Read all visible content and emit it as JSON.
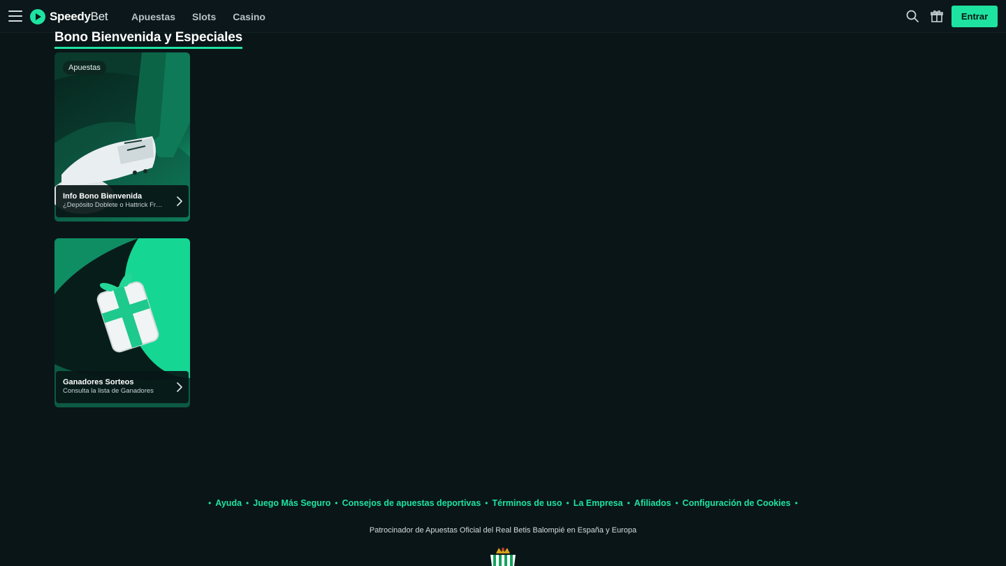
{
  "header": {
    "menu_icon": "hamburger-icon",
    "logo": {
      "bold": "Speedy",
      "thin": "Bet"
    },
    "nav": [
      {
        "label": "Apuestas"
      },
      {
        "label": "Slots"
      },
      {
        "label": "Casino"
      }
    ],
    "search_icon": "search-icon",
    "gift_icon": "gift-icon",
    "enter_label": "Entrar"
  },
  "main": {
    "section_title": "Bono Bienvenida y Especiales",
    "cards": [
      {
        "tag": "Apuestas",
        "title": "Info Bono Bienvenida",
        "subtitle": "¿Depósito Doblete o Hattrick Fr…",
        "art": "football-boot-image"
      },
      {
        "title": "Ganadores Sorteos",
        "subtitle": "Consulta la lista de Ganadores",
        "art": "gift-box-image"
      }
    ]
  },
  "footer": {
    "links": [
      "Ayuda",
      "Juego Más Seguro",
      "Consejos de apuestas deportivas",
      "Términos de uso",
      "La Empresa",
      "Afiliados",
      "Configuración de Cookies"
    ],
    "sponsor_text": "Patrocinador de Apuestas Oficial del Real Betis Balompié en España y Europa"
  },
  "colors": {
    "background": "#0a1518",
    "accent": "#1ee3a0"
  }
}
